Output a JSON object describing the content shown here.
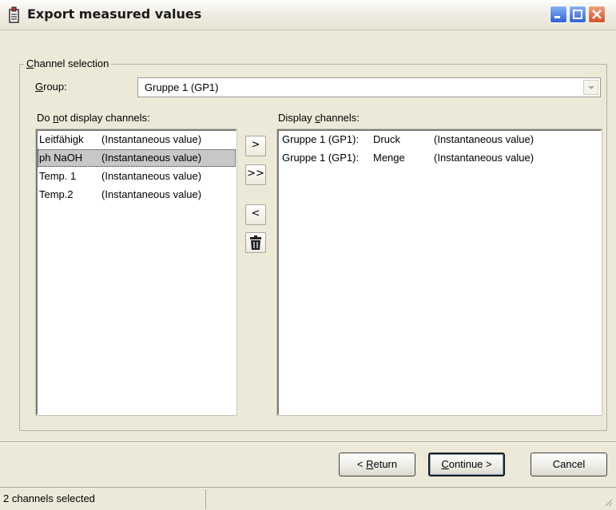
{
  "window": {
    "title": "Export measured values"
  },
  "channel_selection": {
    "legend_prefix": "",
    "legend_accel": "C",
    "legend_rest": "hannel selection",
    "group_label_accel": "G",
    "group_label_rest": "roup:",
    "group_value": "Gruppe 1 (GP1)"
  },
  "left_list": {
    "label_pre": "Do ",
    "label_accel": "n",
    "label_post": "ot display channels:",
    "items": [
      {
        "name": "Leitfähigk",
        "type": "(Instantaneous value)",
        "selected": false
      },
      {
        "name": "ph NaOH",
        "type": "(Instantaneous value)",
        "selected": true
      },
      {
        "name": "Temp. 1",
        "type": "(Instantaneous value)",
        "selected": false
      },
      {
        "name": "Temp.2",
        "type": "(Instantaneous value)",
        "selected": false
      }
    ]
  },
  "right_list": {
    "label_pre": "Display ",
    "label_accel": "c",
    "label_post": "hannels:",
    "items": [
      {
        "group": "Gruppe 1 (GP1):",
        "name": "Druck",
        "type": "(Instantaneous value)"
      },
      {
        "group": "Gruppe 1 (GP1):",
        "name": "Menge",
        "type": "(Instantaneous value)"
      }
    ]
  },
  "shift_buttons": {
    "add_one": ">",
    "add_all": ">>",
    "remove_one": "<",
    "delete_icon": "trash-icon"
  },
  "buttons": {
    "return_pre": "< ",
    "return_accel": "R",
    "return_post": "eturn",
    "continue_accel": "C",
    "continue_post": "ontinue >",
    "cancel": "Cancel"
  },
  "status": {
    "text": "2 channels selected"
  },
  "colors": {
    "window_bg": "#ece9d8",
    "selection": "#c7c7c7",
    "close_button": "#d4512c",
    "title_buttons": "#2f63d6"
  }
}
